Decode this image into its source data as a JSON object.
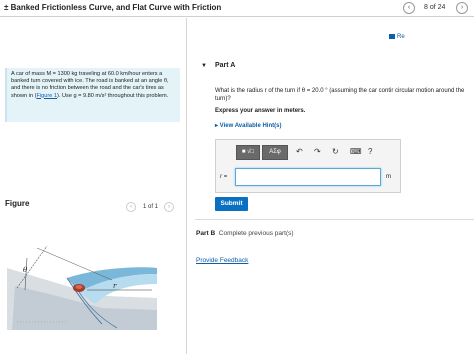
{
  "header": {
    "title": "± Banked Frictionless Curve, and Flat Curve with Friction",
    "prev_label": "‹",
    "next_label": "›",
    "page_count": "8 of 24"
  },
  "intro": {
    "text_before_link": "A car of mass M = 1300 kg traveling at 60.0 km/hour enters a banked turn covered with ice. The road is banked at an angle θ, and there is no friction between the road and the car's tires as shown in (",
    "link": "Figure 1",
    "text_after_link": "). Use g = 9.80 m/s² throughout this problem."
  },
  "figure": {
    "label": "Figure",
    "prev": "‹",
    "next": "›",
    "count": "1 of 1",
    "theta_label": "θ",
    "r_label": "r"
  },
  "review": {
    "label": "Re"
  },
  "part_a": {
    "caret": "▼",
    "title": "Part A",
    "question": "What is the radius r of the turn if θ = 20.0 ° (assuming the car contir circular motion around the turn)?",
    "express": "Express your answer in meters.",
    "hints": "▸  View Available Hint(s)",
    "toolbar_btn1": "■ √□",
    "toolbar_btn2": "ΑΣφ",
    "undo": "↶",
    "redo": "↷",
    "reset": "↻",
    "keyboard": "⌨",
    "help": "?",
    "input_label": "r =",
    "input_value": "",
    "unit": "m",
    "submit": "Submit"
  },
  "part_b": {
    "title": "Part B",
    "text": "Complete previous part(s)"
  },
  "feedback": "Provide Feedback",
  "colors": {
    "link": "#0e5ea8",
    "submit": "#0a70c2",
    "intro_bg": "#e4f3f8",
    "input_border": "#58aadb"
  }
}
